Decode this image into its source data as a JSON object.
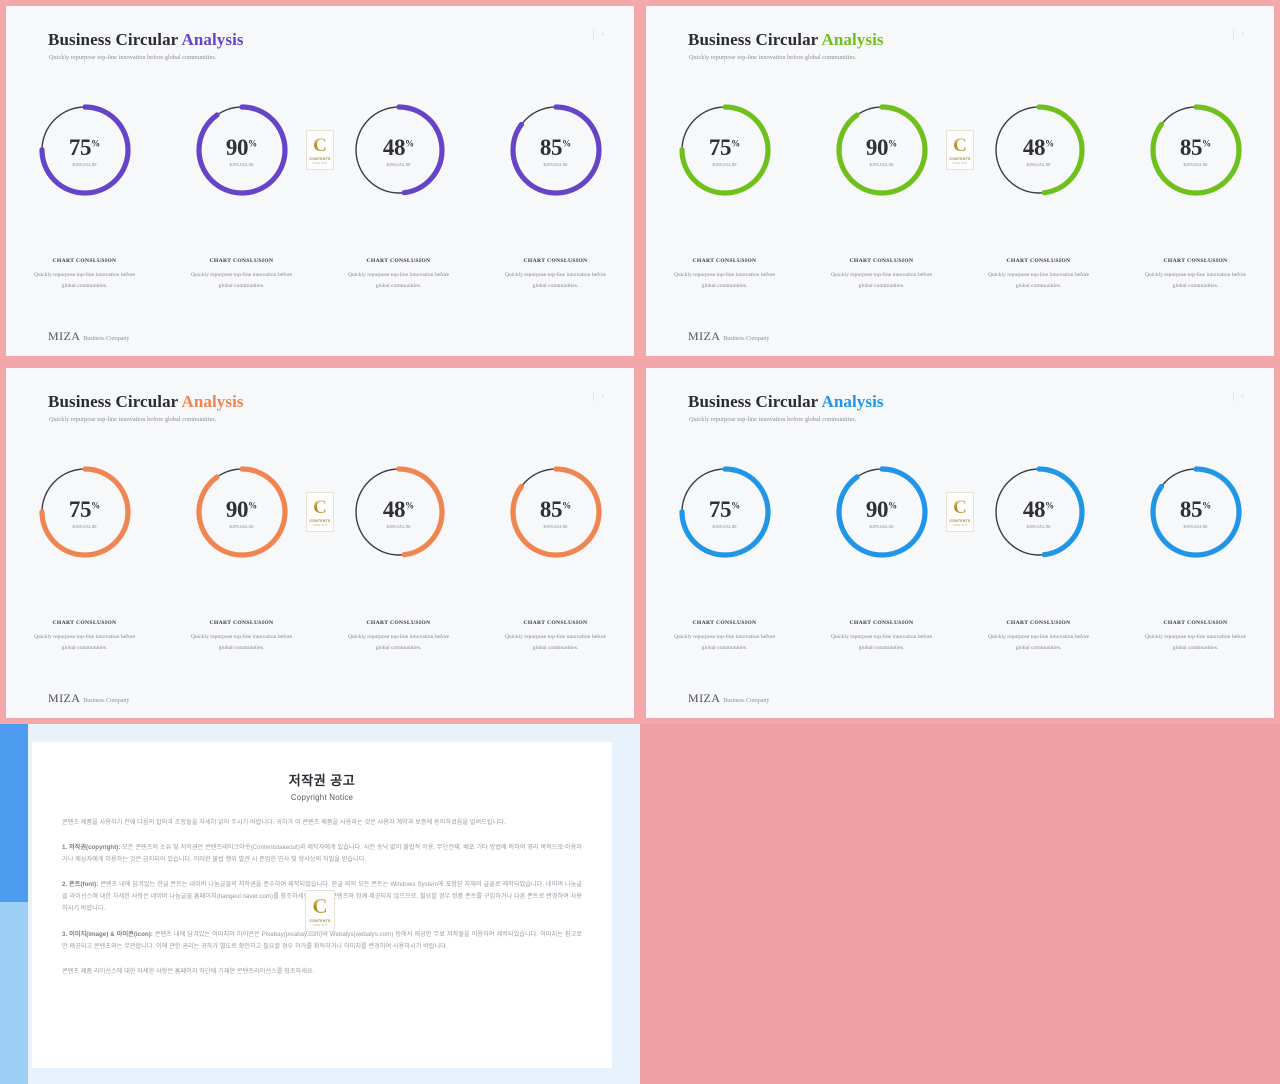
{
  "slides": [
    {
      "title_main": "Business Circular ",
      "title_accent": "Analysis",
      "accent_color": "#6544c8",
      "subtitle": "Quickly repurpose top-line innovation before global communities.",
      "page_number": "4",
      "charts": [
        {
          "value": "75",
          "pct": "%",
          "money": "$185,652.00",
          "percent": 75
        },
        {
          "value": "90",
          "pct": "%",
          "money": "$185,652.00",
          "percent": 90
        },
        {
          "value": "48",
          "pct": "%",
          "money": "$185,652.00",
          "percent": 48
        },
        {
          "value": "85",
          "pct": "%",
          "money": "$185,652.00",
          "percent": 85
        }
      ],
      "captions": [
        {
          "title": "CHART CONSLUSION",
          "body": "Quickly repurpose top-line innovation before global communities."
        },
        {
          "title": "CHART CONSLUSION",
          "body": "Quickly repurpose top-line innovation before global communities."
        },
        {
          "title": "CHART CONSLUSION",
          "body": "Quickly repurpose top-line innovation before global communities."
        },
        {
          "title": "CHART CONSLUSION",
          "body": "Quickly repurpose top-line innovation before global communities."
        }
      ],
      "footer_logo": "MIZA",
      "footer_text": "Business Company"
    },
    {
      "title_main": "Business Circular ",
      "title_accent": "Analysis",
      "accent_color": "#6fc01c",
      "subtitle": "Quickly repurpose top-line innovation before global communities.",
      "page_number": "3",
      "charts": [
        {
          "value": "75",
          "pct": "%",
          "money": "$185,652.00",
          "percent": 75
        },
        {
          "value": "90",
          "pct": "%",
          "money": "$185,652.00",
          "percent": 90
        },
        {
          "value": "48",
          "pct": "%",
          "money": "$185,652.00",
          "percent": 48
        },
        {
          "value": "85",
          "pct": "%",
          "money": "$185,652.00",
          "percent": 85
        }
      ],
      "captions": [
        {
          "title": "CHART CONSLUSION",
          "body": "Quickly repurpose top-line innovation before global communities."
        },
        {
          "title": "CHART CONSLUSION",
          "body": "Quickly repurpose top-line innovation before global communities."
        },
        {
          "title": "CHART CONSLUSION",
          "body": "Quickly repurpose top-line innovation before global communities."
        },
        {
          "title": "CHART CONSLUSION",
          "body": "Quickly repurpose top-line innovation before global communities."
        }
      ],
      "footer_logo": "MIZA",
      "footer_text": "Business Company"
    },
    {
      "title_main": "Business Circular ",
      "title_accent": "Analysis",
      "accent_color": "#f08551",
      "subtitle": "Quickly repurpose top-line innovation before global communities.",
      "page_number": "4",
      "charts": [
        {
          "value": "75",
          "pct": "%",
          "money": "$185,652.00",
          "percent": 75
        },
        {
          "value": "90",
          "pct": "%",
          "money": "$185,652.00",
          "percent": 90
        },
        {
          "value": "48",
          "pct": "%",
          "money": "$185,652.00",
          "percent": 48
        },
        {
          "value": "85",
          "pct": "%",
          "money": "$185,652.00",
          "percent": 85
        }
      ],
      "captions": [
        {
          "title": "CHART CONSLUSION",
          "body": "Quickly repurpose top-line innovation before global communities."
        },
        {
          "title": "CHART CONSLUSION",
          "body": "Quickly repurpose top-line innovation before global communities."
        },
        {
          "title": "CHART CONSLUSION",
          "body": "Quickly repurpose top-line innovation before global communities."
        },
        {
          "title": "CHART CONSLUSION",
          "body": "Quickly repurpose top-line innovation before global communities."
        }
      ],
      "footer_logo": "MIZA",
      "footer_text": "Business Company"
    },
    {
      "title_main": "Business Circular ",
      "title_accent": "Analysis",
      "accent_color": "#2196e8",
      "subtitle": "Quickly repurpose top-line innovation before global communities.",
      "page_number": "5",
      "charts": [
        {
          "value": "75",
          "pct": "%",
          "money": "$185,652.00",
          "percent": 75
        },
        {
          "value": "90",
          "pct": "%",
          "money": "$185,652.00",
          "percent": 90
        },
        {
          "value": "48",
          "pct": "%",
          "money": "$185,652.00",
          "percent": 48
        },
        {
          "value": "85",
          "pct": "%",
          "money": "$185,652.00",
          "percent": 85
        }
      ],
      "captions": [
        {
          "title": "CHART CONSLUSION",
          "body": "Quickly repurpose top-line innovation before global communities."
        },
        {
          "title": "CHART CONSLUSION",
          "body": "Quickly repurpose top-line innovation before global communities."
        },
        {
          "title": "CHART CONSLUSION",
          "body": "Quickly repurpose top-line innovation before global communities."
        },
        {
          "title": "CHART CONSLUSION",
          "body": "Quickly repurpose top-line innovation before global communities."
        }
      ],
      "footer_logo": "MIZA",
      "footer_text": "Business Company"
    }
  ],
  "watermark": {
    "letter": "C",
    "line1": "CONTENTS",
    "line2": "TAKE  OUT"
  },
  "copyright": {
    "heading_ko": "저작권 공고",
    "heading_en": "Copyright Notice",
    "intro": "콘텐츠 제품을 사용하기 전에 다음의 합의과 조항들을 자세히 읽어 주시기 바랍니다. 귀하가 이 콘텐츠 제품을 사용하는 것은 사용자 계약과 보증에 동의하셨음을 알려드립니다.",
    "p1_label": "1. 저작권(copyright):",
    "p1": " 모든 콘텐츠의 소유 및 저작권은 콘텐츠테이크아웃(Contentstakeout)과 제작자에게 있습니다. 사전 승낙 없이 불법적 이용, 무단전재, 배포 기타 방법에 의하여 영리 목적으로 이용하거나 제삼자에게 이용하는 것은 금지되어 있습니다. 이러한 불법 행위 발견 시 준엄한 민사 및 형사상의 처벌을 받습니다.",
    "p2_label": "2. 폰트(font):",
    "p2": " 콘텐츠 내에 담겨있는 한글 폰트는 네이버 나눔글꼴의 저작권을 준수하여 제작되었습니다. 한글 외의 모든 폰트는 Windows System에 포함된 자체의 글꼴로 제작되었습니다. 네이버 나눔글꼴 라이선스에 대한 자세한 사항은 네이버 나눔글꼴 홈페이지(hangeul.naver.com)를 참조하세요. 폰트는 콘텐츠와 함께 제공되지 않으므로, 필요할 경우 정품 폰트를 구입하거나 다른 폰트로 변경하여 사용하시기 바랍니다.",
    "p3_label": "3. 이미지(image) & 아이콘(icon):",
    "p3": " 콘텐츠 내에 담겨있는 이미지와 아이콘은 Pixabay(pixabay.com)와 Webalys(webalys.com) 등에서 제공한 무료 저작물을 이용하여 제작되었습니다. 이미지는 참고로만 제공되고 콘텐츠와는 무관합니다. 이에 관한 권리는 귀하가 별도로 확인하고 필요할 경우 허가를 취득하거나 이미지를 변경하여 사용하시기 바랍니다.",
    "closing": "콘텐츠 제품 라이선스에 대한 자세한 사항은 홈페이지 하단에 기재한 콘텐츠라이선스를 참조하세요."
  }
}
